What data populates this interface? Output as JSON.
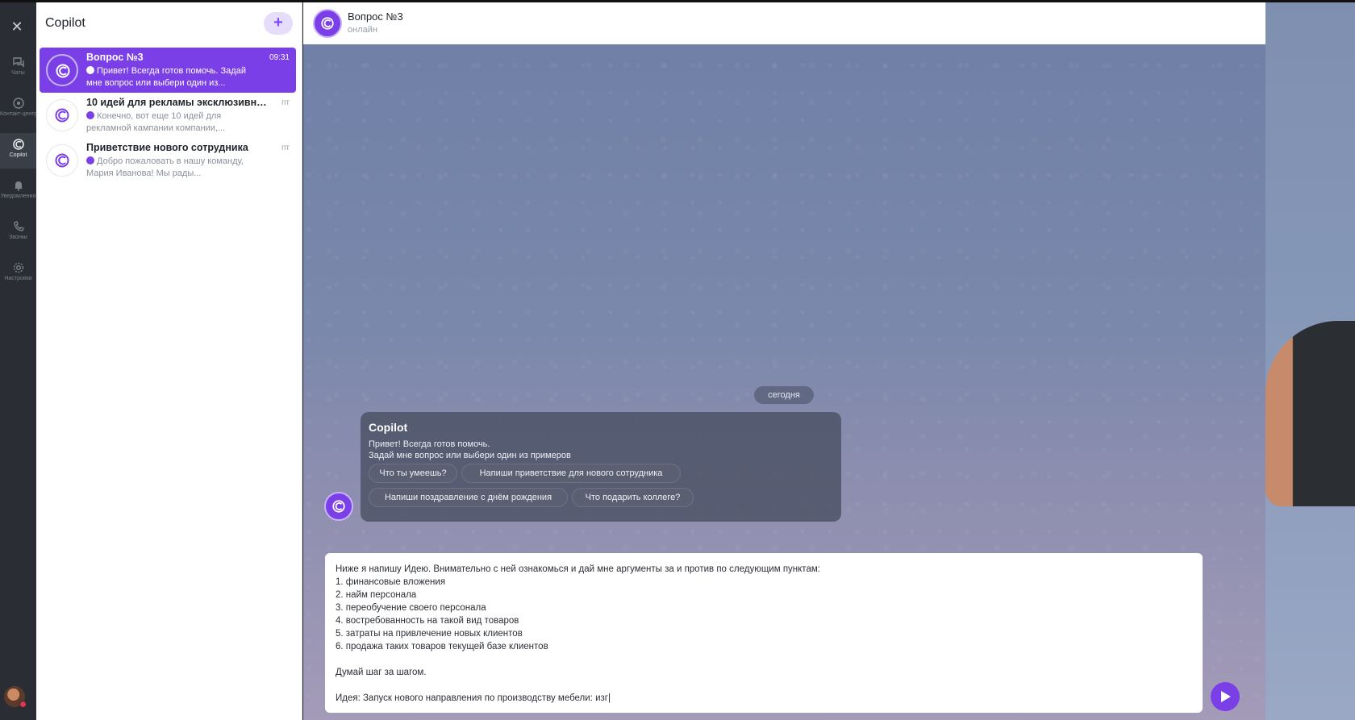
{
  "rail": {
    "items": [
      {
        "label": "Чаты",
        "icon": "chat-bubbles-icon"
      },
      {
        "label": "Контакт-центр",
        "icon": "contact-center-icon"
      },
      {
        "label": "Copilot",
        "icon": "copilot-icon"
      },
      {
        "label": "Уведомления",
        "icon": "bell-icon"
      },
      {
        "label": "Звонки",
        "icon": "phone-icon"
      },
      {
        "label": "Настройки",
        "icon": "gear-icon"
      }
    ],
    "active": "Copilot"
  },
  "list": {
    "title": "Copilot",
    "add_label": "+",
    "chats": [
      {
        "title": "Вопрос №3",
        "time": "09:31",
        "preview": "Привет! Всегда готов помочь. Задай мне вопрос или выбери один из..."
      },
      {
        "title": "10 идей для рекламы эксклюзивной ...",
        "time": "пт",
        "preview": "Конечно, вот еще 10 идей для рекламной кампании компании,..."
      },
      {
        "title": "Приветствие нового сотрудника",
        "time": "пт",
        "preview": "Добро пожаловать в нашу команду, Мария Иванова! Мы рады..."
      }
    ]
  },
  "chat": {
    "title": "Вопрос №3",
    "status": "онлайн",
    "date_divider": "сегодня",
    "message": {
      "sender": "Copilot",
      "line1": "Привет! Всегда готов помочь.",
      "line2": "Задай мне вопрос или выбери один из примеров",
      "chips": [
        "Что ты умеешь?",
        "Напиши приветствие для нового сотрудника",
        "Напиши поздравление с днём рождения",
        "Что подарить коллеге?"
      ]
    },
    "composer_lines": [
      "Ниже я напишу Идею. Внимательно с ней ознакомься и дай мне аргументы за и против по следующим пунктам:",
      "1. финансовые вложения",
      "2. найм персонала",
      "3. переобучение своего персонала",
      "4. востребованность на такой вид товаров",
      "5. затраты на привлечение новых клиентов",
      "6. продажа таких товаров текущей базе клиентов",
      "",
      "Думай шаг за шагом.",
      "",
      "Идея: Запуск нового направления по производству мебели: изг|"
    ]
  },
  "colors": {
    "accent": "#7b3fe8",
    "accent_light": "#e6ddfb",
    "rail_bg": "#2a2e34"
  }
}
